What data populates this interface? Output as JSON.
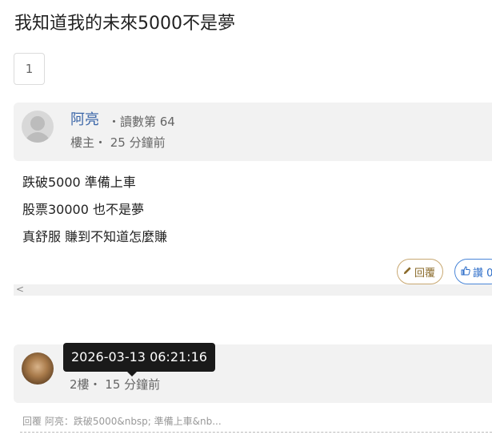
{
  "thread": {
    "title": "我知道我的未來5000不是夢"
  },
  "pagination": {
    "current_page": "1"
  },
  "post1": {
    "author": "阿亮",
    "read_count": "・讀數第 64",
    "floor_line": "樓主・ 25 分鐘前",
    "content_lines": [
      "跌破5000  準備上車",
      "股票30000 也不是夢",
      "真舒服 賺到不知道怎麼賺"
    ],
    "reply_label": "回覆",
    "like_label": "讚 0",
    "reply_icon": "pencil-icon",
    "like_icon": "thumbs-up-icon"
  },
  "post2": {
    "floor_line": "2樓・ 15 分鐘前",
    "tooltip": "2026-03-13 06:21:16",
    "reply_preview": "回覆 阿亮：跌破5000&nbsp; 準備上車&nb..."
  },
  "scrollbar": {
    "left_arrow": "<"
  }
}
